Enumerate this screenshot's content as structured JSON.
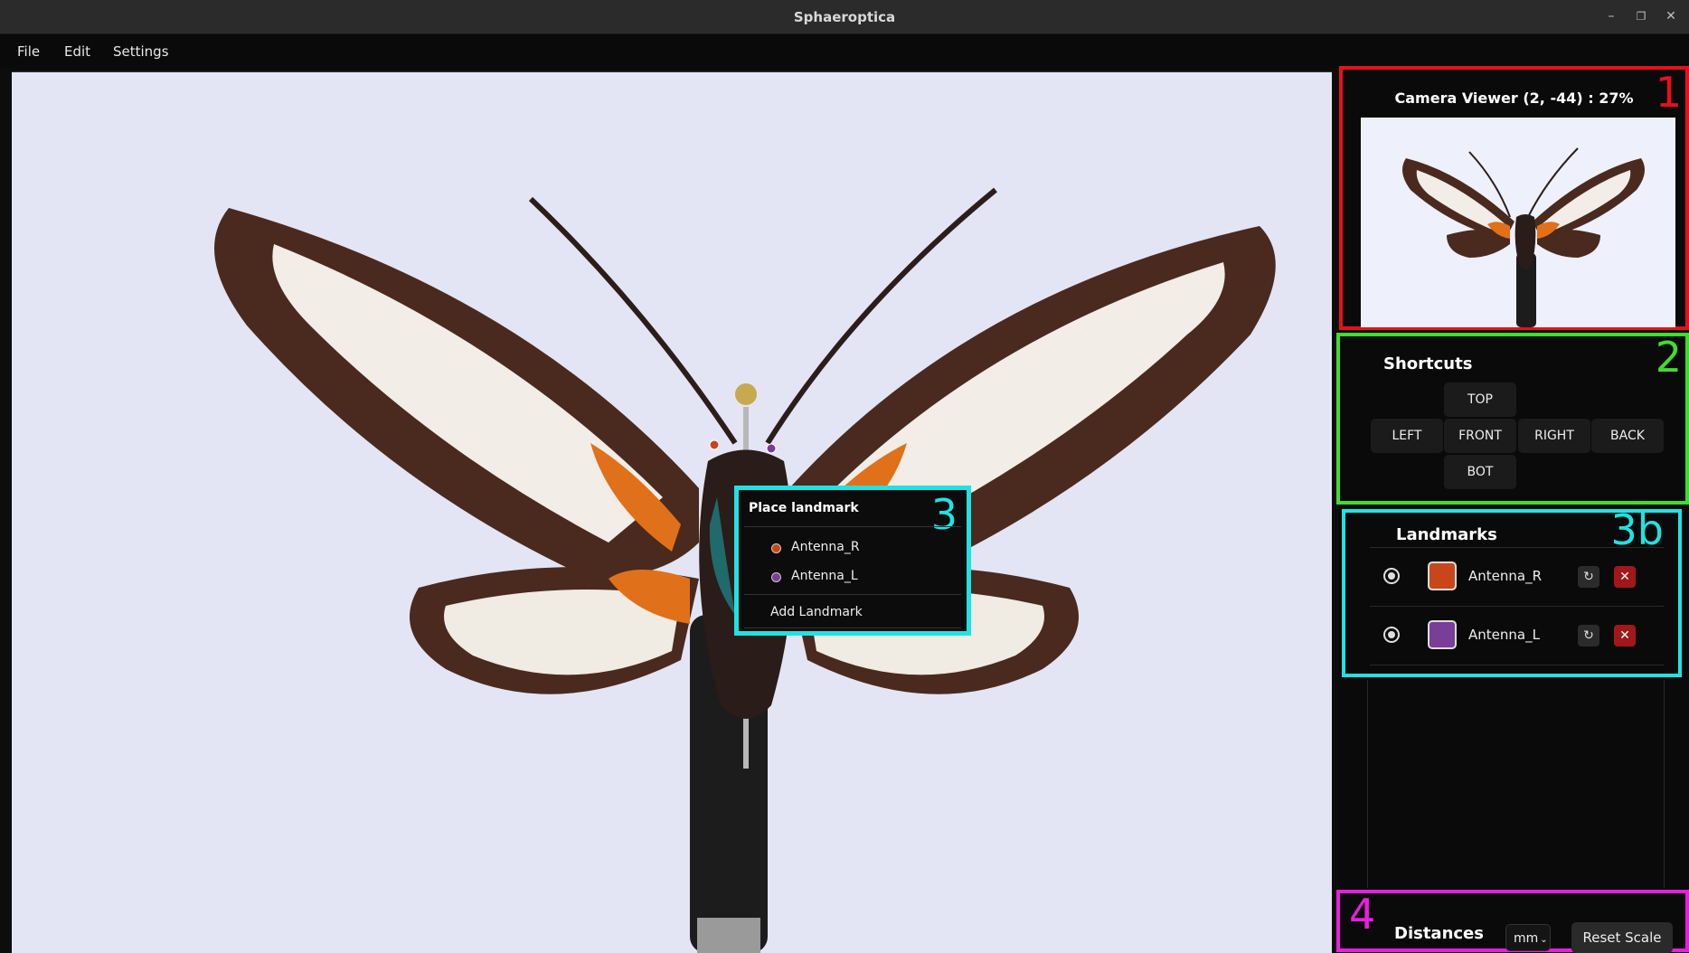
{
  "window": {
    "title": "Sphaeroptica"
  },
  "menu": [
    "File",
    "Edit",
    "Settings"
  ],
  "camera_viewer": {
    "label": "Camera Viewer (2, -44) : 27%",
    "annotation": "1"
  },
  "shortcuts": {
    "label": "Shortcuts",
    "annotation": "2",
    "buttons": {
      "top": "TOP",
      "left": "LEFT",
      "front": "FRONT",
      "right": "RIGHT",
      "back": "BACK",
      "bot": "BOT"
    }
  },
  "popup": {
    "title": "Place landmark",
    "annotation": "3",
    "items": [
      "Antenna_R",
      "Antenna_L"
    ],
    "add_label": "Add Landmark"
  },
  "landmarks": {
    "label": "Landmarks",
    "annotation": "3b",
    "items": [
      {
        "name": "Antenna_R",
        "color": "#c8461a"
      },
      {
        "name": "Antenna_L",
        "color": "#7a3d99"
      }
    ]
  },
  "distances": {
    "label": "Distances",
    "annotation": "4",
    "unit": "mm",
    "reset_label": "Reset Scale"
  },
  "colors": {
    "red": "#e8101a",
    "green": "#41dd2e",
    "cyan": "#1fe3e3",
    "magenta": "#e91ee0"
  }
}
